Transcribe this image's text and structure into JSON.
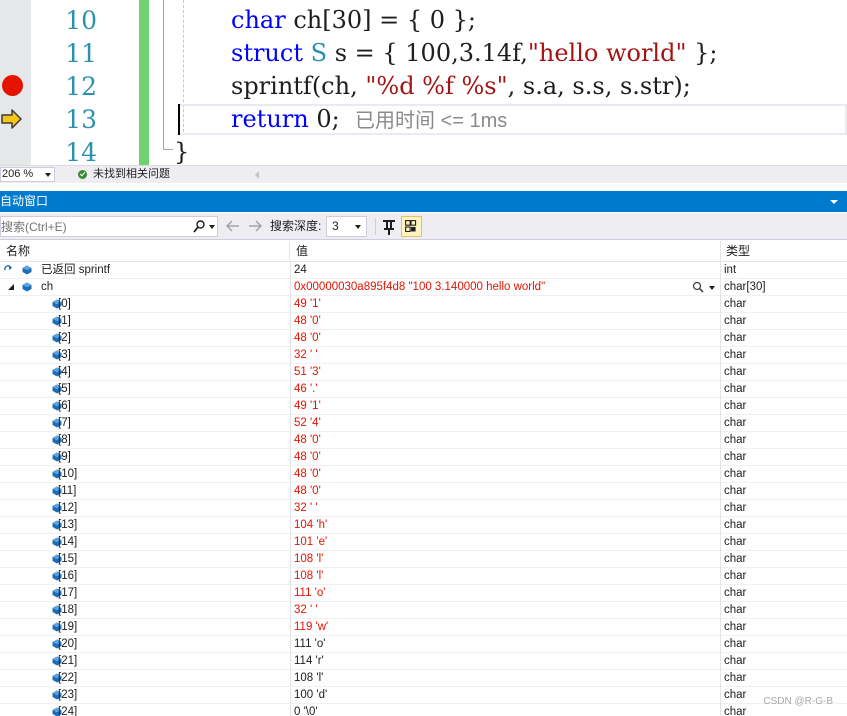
{
  "editor": {
    "line_numbers": [
      "10",
      "11",
      "12",
      "13",
      "14"
    ],
    "lines": [
      [
        {
          "t": "char",
          "c": "kw"
        },
        {
          "t": " ch[30] = { 0 };",
          "c": ""
        }
      ],
      [
        {
          "t": "struct",
          "c": "kw"
        },
        {
          "t": " ",
          "c": ""
        },
        {
          "t": "S",
          "c": "ty"
        },
        {
          "t": " s = { 100,3.14f,",
          "c": ""
        },
        {
          "t": "\"hello world\"",
          "c": "st"
        },
        {
          "t": " };",
          "c": ""
        }
      ],
      [
        {
          "t": "sprintf(ch, ",
          "c": ""
        },
        {
          "t": "\"%d %f %s\"",
          "c": "st"
        },
        {
          "t": ", s.a, s.s, s.str);",
          "c": ""
        }
      ],
      [
        {
          "t": "return",
          "c": "kw"
        },
        {
          "t": " 0;",
          "c": ""
        }
      ]
    ],
    "closing_brace": "}",
    "perf_tip": "已用时间 <= 1ms",
    "breakpoint_line": "12",
    "current_line": "13"
  },
  "status": {
    "zoom": "206 %",
    "issues": "未找到相关问题"
  },
  "autos": {
    "title": "自动窗口",
    "search_placeholder": "搜索(Ctrl+E)",
    "depth_label": "搜索深度:",
    "depth_value": "3",
    "columns": {
      "name": "名称",
      "value": "值",
      "type": "类型"
    },
    "rows": [
      {
        "name": "已返回 sprintf",
        "value": "24",
        "type": "int",
        "level": 0,
        "expander": "none",
        "icon": "return-icon",
        "changed": false
      },
      {
        "name": "ch",
        "value": "0x00000030a895f4d8 \"100 3.140000 hello world\"",
        "type": "char[30]",
        "level": 0,
        "expander": "expanded",
        "icon": "variable-icon",
        "changed": true,
        "visualizer": true
      },
      {
        "name": "[0]",
        "value": "49 '1'",
        "type": "char",
        "level": 1,
        "changed": true
      },
      {
        "name": "[1]",
        "value": "48 '0'",
        "type": "char",
        "level": 1,
        "changed": true
      },
      {
        "name": "[2]",
        "value": "48 '0'",
        "type": "char",
        "level": 1,
        "changed": true
      },
      {
        "name": "[3]",
        "value": "32 ' '",
        "type": "char",
        "level": 1,
        "changed": true
      },
      {
        "name": "[4]",
        "value": "51 '3'",
        "type": "char",
        "level": 1,
        "changed": true
      },
      {
        "name": "[5]",
        "value": "46 '.'",
        "type": "char",
        "level": 1,
        "changed": true
      },
      {
        "name": "[6]",
        "value": "49 '1'",
        "type": "char",
        "level": 1,
        "changed": true
      },
      {
        "name": "[7]",
        "value": "52 '4'",
        "type": "char",
        "level": 1,
        "changed": true
      },
      {
        "name": "[8]",
        "value": "48 '0'",
        "type": "char",
        "level": 1,
        "changed": true
      },
      {
        "name": "[9]",
        "value": "48 '0'",
        "type": "char",
        "level": 1,
        "changed": true
      },
      {
        "name": "[10]",
        "value": "48 '0'",
        "type": "char",
        "level": 1,
        "changed": true
      },
      {
        "name": "[11]",
        "value": "48 '0'",
        "type": "char",
        "level": 1,
        "changed": true
      },
      {
        "name": "[12]",
        "value": "32 ' '",
        "type": "char",
        "level": 1,
        "changed": true
      },
      {
        "name": "[13]",
        "value": "104 'h'",
        "type": "char",
        "level": 1,
        "changed": true
      },
      {
        "name": "[14]",
        "value": "101 'e'",
        "type": "char",
        "level": 1,
        "changed": true
      },
      {
        "name": "[15]",
        "value": "108 'l'",
        "type": "char",
        "level": 1,
        "changed": true
      },
      {
        "name": "[16]",
        "value": "108 'l'",
        "type": "char",
        "level": 1,
        "changed": true
      },
      {
        "name": "[17]",
        "value": "111 'o'",
        "type": "char",
        "level": 1,
        "changed": true
      },
      {
        "name": "[18]",
        "value": "32 ' '",
        "type": "char",
        "level": 1,
        "changed": true
      },
      {
        "name": "[19]",
        "value": "119 'w'",
        "type": "char",
        "level": 1,
        "changed": true
      },
      {
        "name": "[20]",
        "value": "111 'o'",
        "type": "char",
        "level": 1,
        "changed": false
      },
      {
        "name": "[21]",
        "value": "114 'r'",
        "type": "char",
        "level": 1,
        "changed": false
      },
      {
        "name": "[22]",
        "value": "108 'l'",
        "type": "char",
        "level": 1,
        "changed": false
      },
      {
        "name": "[23]",
        "value": "100 'd'",
        "type": "char",
        "level": 1,
        "changed": false
      },
      {
        "name": "[24]",
        "value": "0 '\\0'",
        "type": "char",
        "level": 1,
        "changed": false
      }
    ]
  },
  "watermark": "CSDN @R-G-B",
  "colors": {
    "accent": "#007acc",
    "changed_value": "#e51400",
    "breakpoint": "#e51400",
    "exec_arrow": "#f5c518",
    "keyword": "#0000ff",
    "string": "#a31515",
    "type": "#2b91af",
    "variable_icon": "#1c6fb5"
  }
}
